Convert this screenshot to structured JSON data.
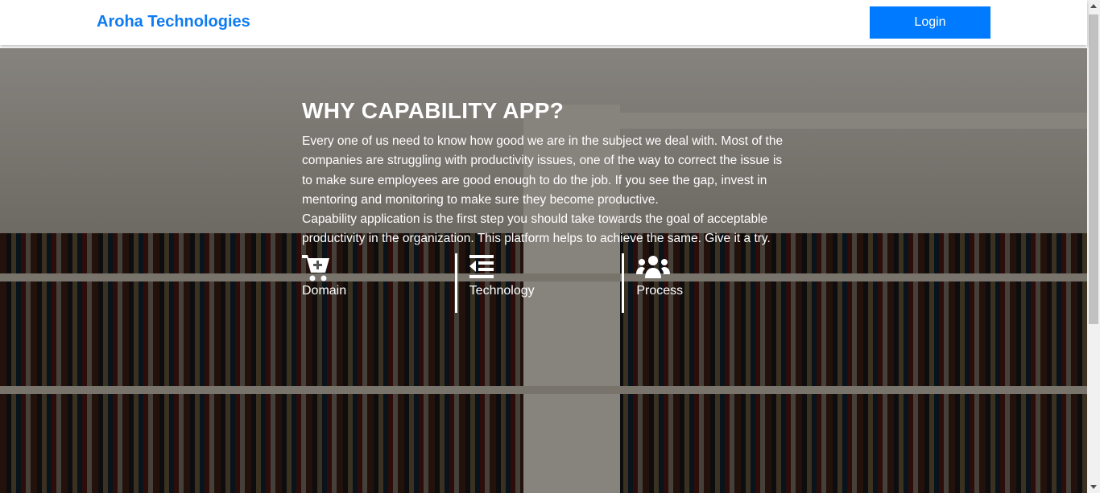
{
  "header": {
    "brand": "Aroha Technologies",
    "login_label": "Login"
  },
  "hero": {
    "title": "WHY CAPABILITY APP?",
    "paragraph1": "Every one of us need to know how good we are in the subject we deal with. Most of the companies are struggling with productivity issues, one of the way to correct the issue is to make sure employees are good enough to do the job. If you see the gap, invest in mentoring and monitoring to make sure they become productive.",
    "paragraph2": "Capability application is the first step you should take towards the goal of acceptable productivity in the organization. This platform helps to achieve the same. Give it a try.",
    "features": [
      {
        "label": "Domain",
        "icon": "cart-plus-icon"
      },
      {
        "label": "Technology",
        "icon": "outdent-icon"
      },
      {
        "label": "Process",
        "icon": "users-icon"
      }
    ]
  }
}
